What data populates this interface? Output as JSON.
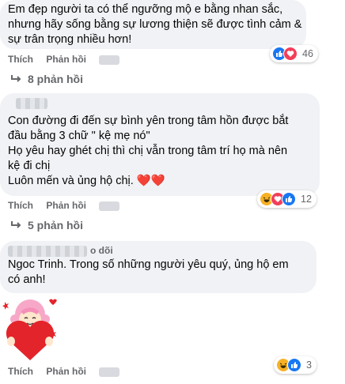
{
  "comment1": {
    "text_lines": [
      "Em đẹp người ta có thể ngưỡng mộ e bằng nhan sắc,",
      "nhưng hãy sống bằng sự lương thiện sẽ được tình cảm &",
      "sự trân trọng nhiều hơn!"
    ],
    "like_label": "Thích",
    "reply_label": "Phản hồi",
    "reaction_count": "46",
    "replies_label": "8 phản hồi"
  },
  "comment2": {
    "text_lines": [
      "Con đường đi đến sự bình yên trong tâm hồn được bắt",
      "đầu bằng 3 chữ \" kệ mẹ nó\"",
      "Họ yêu hay ghét chị thì chị vẫn trong tâm trí họ mà nên",
      "kệ đi chị",
      "Luôn mến và ủng hộ chị. ❤️❤️"
    ],
    "like_label": "Thích",
    "reply_label": "Phản hồi",
    "reaction_count": "12",
    "replies_label": "5 phản hồi"
  },
  "comment3": {
    "follow_label": "o dõi",
    "text_lines": [
      "Ngoc Trinh. Trong số những người yêu quý, ủng hộ em",
      "có anh!"
    ],
    "like_label": "Thích",
    "reply_label": "Phản hồi",
    "reaction_count": "3"
  },
  "colors": {
    "bubble": "#f0f2f5",
    "meta": "#65676b",
    "like": "#1877f2",
    "love": "#f33e58",
    "haha": "#f7b125"
  },
  "icons": [
    "like-icon",
    "love-icon",
    "haha-icon",
    "reply-arrow-icon",
    "heart-sticker"
  ]
}
